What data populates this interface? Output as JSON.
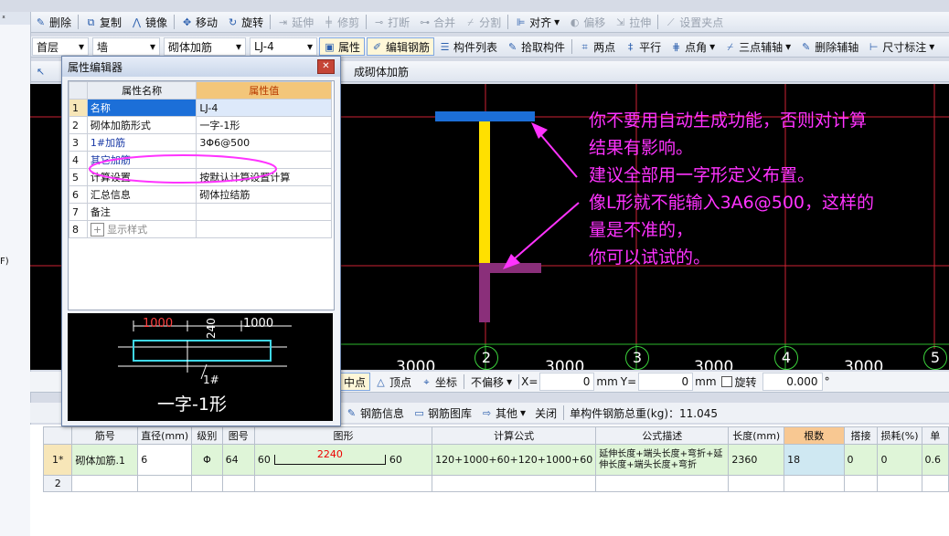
{
  "toolbar1": {
    "items": [
      "删除",
      "复制",
      "镜像",
      "移动",
      "旋转",
      "延伸",
      "修剪",
      "打断",
      "合并",
      "分割",
      "对齐",
      "偏移",
      "拉伸",
      "设置夹点"
    ]
  },
  "toolbar2": {
    "floor": "首层",
    "type": "墙",
    "category": "砌体加筋",
    "element": "LJ-4",
    "attr": "属性",
    "edit_rebar": "编辑钢筋",
    "list": "构件列表",
    "pick": "拾取构件",
    "two_point": "两点",
    "parallel": "平行",
    "point_angle": "点角",
    "three_point_axis": "三点辅轴",
    "delete_axis": "删除辅轴",
    "dimension": "尺寸标注"
  },
  "toolbar3": {
    "generate": "成砌体加筋"
  },
  "editor": {
    "title": "属性编辑器",
    "col_name": "属性名称",
    "col_value": "属性值",
    "rows": [
      {
        "no": "1",
        "name": "名称",
        "value": "LJ-4"
      },
      {
        "no": "2",
        "name": "砌体加筋形式",
        "value": "一字-1形"
      },
      {
        "no": "3",
        "name": "1#加筋",
        "value": "3Φ6@500"
      },
      {
        "no": "4",
        "name": "其它加筋",
        "value": ""
      },
      {
        "no": "5",
        "name": "计算设置",
        "value": "按默认计算设置计算"
      },
      {
        "no": "6",
        "name": "汇总信息",
        "value": "砌体拉结筋"
      },
      {
        "no": "7",
        "name": "备注",
        "value": ""
      },
      {
        "no": "8",
        "name": "显示样式",
        "value": ""
      }
    ],
    "diagram": {
      "dim_left": "1000",
      "dim_right": "1000",
      "dim_vert": "240",
      "bar_label": "1#",
      "caption": "一字-1形"
    }
  },
  "canvas": {
    "annotation": [
      "你不要用自动生成功能，否则对计算",
      "结果有影响。",
      "建议全部用一字形定义布置。",
      "像L形就不能输入3A6@500，这样的",
      "量是不准的，",
      "你可以试试的。"
    ],
    "axes": [
      "2",
      "3",
      "4",
      "5"
    ],
    "spacing": "3000"
  },
  "bottom_toolbar": {
    "midpoint": "中点",
    "vertex": "顶点",
    "coord": "坐标",
    "no_offset": "不偏移",
    "x_label": "X=",
    "x_value": "0",
    "y_label": "Y=",
    "y_value": "0",
    "unit": "mm",
    "rotate": "旋转",
    "rotate_value": "0.000",
    "degree": "°"
  },
  "rebar_toolbar": {
    "info": "钢筋信息",
    "library": "钢筋图库",
    "other": "其他",
    "close": "关闭",
    "weight_label": "单构件钢筋总重(kg)：11.045"
  },
  "grid": {
    "headers": [
      "筋号",
      "直径(mm)",
      "级别",
      "图号",
      "图形",
      "计算公式",
      "公式描述",
      "长度(mm)",
      "根数",
      "搭接",
      "损耗(%)",
      "单"
    ],
    "rows": [
      {
        "no": "1*",
        "name": "砌体加筋.1",
        "dia": "6",
        "grade": "Φ",
        "fig": "64",
        "shape_left": "60",
        "shape_mid": "2240",
        "shape_right": "60",
        "formula": "120+1000+60+120+1000+60",
        "desc": "延伸长度+端头长度+弯折+延伸长度+端头长度+弯折",
        "length": "2360",
        "count": "18",
        "lap": "0",
        "loss": "0",
        "unit": "0.6"
      },
      {
        "no": "2"
      }
    ]
  },
  "left_panel": {
    "label": "F)"
  },
  "colors": {
    "canvas_bg": "#000000",
    "annotation": "#ff33ff",
    "axis_line": "#cc2233",
    "grid_line": "#2db82d",
    "selected_row": "#dff5d8",
    "count_header": "#f8c892",
    "editor_header_value": "#f3c67a"
  }
}
